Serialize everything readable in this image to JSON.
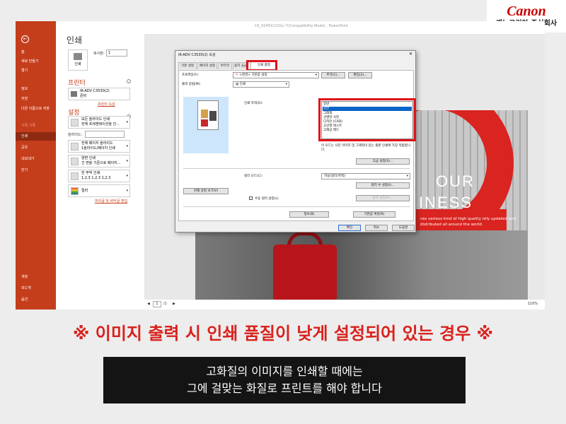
{
  "brand": {
    "logo": "Canon",
    "subtitle": "캐논코리아 주식회사"
  },
  "window_title": "CK_6245X1102a 기(Compatibility Mode) · PowerPoint",
  "sidebar": {
    "items": [
      {
        "label": "홈"
      },
      {
        "label": "새로 만들기"
      },
      {
        "label": "열기"
      },
      {
        "label": "정보"
      },
      {
        "label": "저장"
      },
      {
        "label": "다른 이름으로 저장"
      },
      {
        "label": "기록 기록"
      },
      {
        "label": "인쇄"
      },
      {
        "label": "공유"
      },
      {
        "label": "내보내기"
      },
      {
        "label": "닫기"
      },
      {
        "label": "계정"
      },
      {
        "label": "피드백"
      },
      {
        "label": "옵션"
      }
    ]
  },
  "print_pane": {
    "title": "인쇄",
    "print_button": "인쇄",
    "copies_label": "복사본:",
    "copies_value": "1",
    "printer_heading": "프린터",
    "printer_name": "iR-ADV C3530(2)",
    "printer_status": "준비",
    "printer_props_link": "프린터 속성",
    "settings_heading": "설정",
    "settings": [
      {
        "line1": "모든 슬라이드 인쇄",
        "line2": "전체 프레젠테이션을 인..."
      },
      {
        "line1": "전체 페이지 슬라이드",
        "line2": "1슬라이드/페이지 인쇄"
      },
      {
        "line1": "양면 인쇄",
        "line2": "긴 면을 기준으로 페이지..."
      },
      {
        "line1": "한 부씩 인쇄",
        "line2": "1,2,3   1,2,3   1,2,3"
      },
      {
        "line1": "컬러",
        "line2": ""
      }
    ],
    "pages_label": "슬라이드:",
    "edit_header_link": "머리글 및 바닥글 편집"
  },
  "preview": {
    "heading1": "OUR",
    "heading2": "INESS",
    "body": "ces various kind of high quality ntly updated and distributed all around the world.",
    "page_value": "1",
    "page_total": "/1",
    "zoom": "110%"
  },
  "dialog": {
    "title": "iR-ADV C3530(2) 속성",
    "close": "✕",
    "tabs": [
      "기본 설정",
      "페이지 설정",
      "마무리",
      "용지 공급",
      "인쇄 품질"
    ],
    "profile_label": "프로파일(F):",
    "profile_value": "<변경> 기본값 설정",
    "add_btn": "추가(1)...",
    "edit_btn": "편집(2)...",
    "output_label": "출력 방법(M):",
    "output_value": "인쇄",
    "quality_label": "인쇄 목적(O):",
    "quality_options": [
      "일반",
      "일반",
      "그래픽",
      "선명한 사진",
      "디자인 (CAD)",
      "고선명 텍스트",
      "고해상 레드"
    ],
    "quality_help": "이 모드는 사진 이미지 및 그래픽이 있는 출판 인쇄에 가장 적합합니다.",
    "advanced_btn": "고급 설정(S)...",
    "color_mode_label": "컬러 모드(C):",
    "color_mode_value": "자동[컬러/흑백]",
    "color_detail_btn": "컬러 수 설정(I)...",
    "color_settings_btn": "컬러 설정(R)...",
    "manual_color_label": "수동 컬러 설정(L)",
    "view_settings_btn": "현재 설정 보기(V)",
    "info_btn": "정보(B)",
    "restore_btn": "기본값 복원(R)",
    "ok_btn": "확인",
    "cancel_btn": "취소",
    "help_btn": "도움말"
  },
  "caption": {
    "headline": "※ 이미지 출력 시 인쇄 품질이 낮게 설정되어 있는 경우 ※",
    "line1": "고화질의 이미지를 인쇄할 때에는",
    "line2": "그에 걸맞는 화질로 프린트를 해야 합니다"
  },
  "colors": {
    "accent": "#c43e1c",
    "highlight": "#e0121a",
    "headline": "#d9211c"
  }
}
